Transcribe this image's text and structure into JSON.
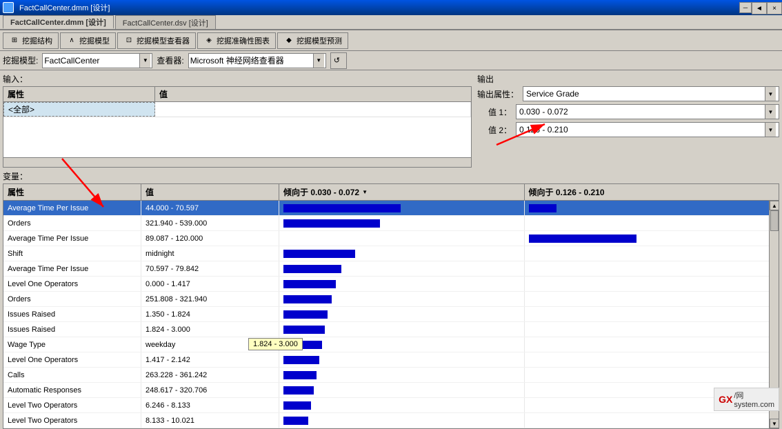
{
  "titleBar": {
    "text": "FactCallCenter.dmm [设计]",
    "tab1": "FactCallCenter.dmm [设计]",
    "tab2": "FactCallCenter.dsv [设计]",
    "closeBtn": "×",
    "minBtn": "─",
    "maxBtn": "□"
  },
  "toolbar": {
    "btn1": "挖掘结构",
    "btn2": "挖掘模型",
    "btn3": "挖掘模型查看器",
    "btn4": "挖掘准确性图表",
    "btn5": "挖掘模型预测",
    "modelLabel": "挖掘模型:",
    "modelValue": "FactCallCenter",
    "viewerLabel": "查看器:",
    "viewerValue": "Microsoft 神经网络查看器",
    "refreshIcon": "↺"
  },
  "inputSection": {
    "label": "输入：",
    "col1": "属性",
    "col2": "值",
    "row1": "<全部>"
  },
  "outputSection": {
    "label": "输出",
    "outputAttrLabel": "输出属性：",
    "outputAttrValue": "Service Grade",
    "val1Label": "值 1：",
    "val1Value": "0.030 - 0.072",
    "val2Label": "值 2：",
    "val2Value": "0.126 - 0.210"
  },
  "variablesSection": {
    "label": "变量：",
    "col1": "属性",
    "col2": "值",
    "col3": "倾向于 0.030 - 0.072",
    "col3Sort": "▼",
    "col4": "倾向于 0.126 - 0.210",
    "rows": [
      {
        "attr": "Average Time Per Issue",
        "val": "44.000 - 70.597",
        "bar1": 85,
        "bar2": 20,
        "selected": true
      },
      {
        "attr": "Orders",
        "val": "321.940 - 539.000",
        "bar1": 70,
        "bar2": 0,
        "selected": false
      },
      {
        "attr": "Average Time Per Issue",
        "val": "89.087 - 120.000",
        "bar1": 0,
        "bar2": 78,
        "selected": false
      },
      {
        "attr": "Shift",
        "val": "midnight",
        "bar1": 52,
        "bar2": 0,
        "selected": false
      },
      {
        "attr": "Average Time Per Issue",
        "val": "70.597 - 79.842",
        "bar1": 42,
        "bar2": 0,
        "selected": false
      },
      {
        "attr": "Level One Operators",
        "val": "0.000 - 1.417",
        "bar1": 38,
        "bar2": 0,
        "selected": false
      },
      {
        "attr": "Orders",
        "val": "251.808 - 321.940",
        "bar1": 35,
        "bar2": 0,
        "selected": false
      },
      {
        "attr": "Issues Raised",
        "val": "1.350 - 1.824",
        "bar1": 32,
        "bar2": 0,
        "selected": false
      },
      {
        "attr": "Issues Raised",
        "val": "1.824 - 3.000",
        "bar1": 30,
        "bar2": 0,
        "selected": false
      },
      {
        "attr": "Wage Type",
        "val": "weekday",
        "bar1": 28,
        "bar2": 0,
        "selected": false
      },
      {
        "attr": "Level One Operators",
        "val": "1.417 - 2.142",
        "bar1": 26,
        "bar2": 0,
        "selected": false
      },
      {
        "attr": "Calls",
        "val": "263.228 - 361.242",
        "bar1": 24,
        "bar2": 0,
        "selected": false
      },
      {
        "attr": "Automatic Responses",
        "val": "248.617 - 320.706",
        "bar1": 22,
        "bar2": 0,
        "selected": false
      },
      {
        "attr": "Level Two Operators",
        "val": "6.246 - 8.133",
        "bar1": 20,
        "bar2": 0,
        "selected": false
      },
      {
        "attr": "Level Two Operators",
        "val": "8.133 - 10.021",
        "bar1": 18,
        "bar2": 0,
        "selected": false
      }
    ]
  },
  "tooltip": {
    "text": "1.824 - 3.000"
  },
  "watermark": {
    "text": "GX/网",
    "sub": "system.com"
  }
}
